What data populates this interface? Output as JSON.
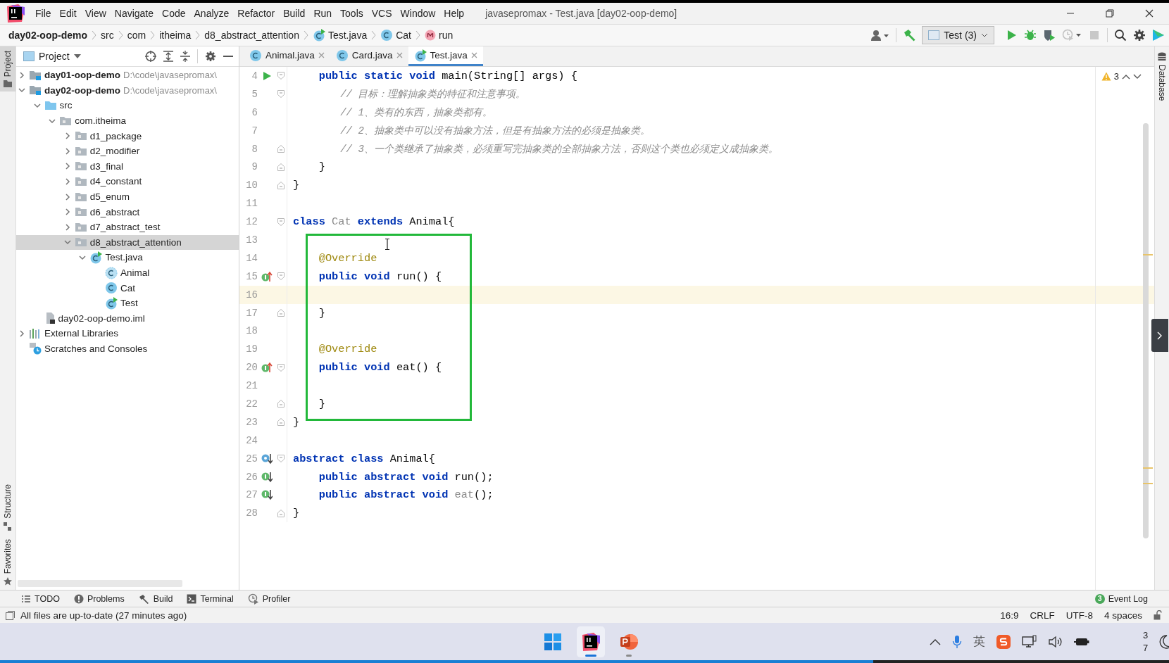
{
  "window": {
    "title": "javasepromax - Test.java [day02-oop-demo]"
  },
  "menu": [
    "File",
    "Edit",
    "View",
    "Navigate",
    "Code",
    "Analyze",
    "Refactor",
    "Build",
    "Run",
    "Tools",
    "VCS",
    "Window",
    "Help"
  ],
  "breadcrumbs": [
    {
      "kind": "module",
      "label": "day02-oop-demo"
    },
    {
      "kind": "folder",
      "label": "src"
    },
    {
      "kind": "folder",
      "label": "com"
    },
    {
      "kind": "folder",
      "label": "itheima"
    },
    {
      "kind": "folder",
      "label": "d8_abstract_attention"
    },
    {
      "kind": "test-class",
      "label": "Test.java"
    },
    {
      "kind": "class",
      "label": "Cat"
    },
    {
      "kind": "method",
      "label": "run"
    }
  ],
  "toolbar": {
    "run_config": "Test (3)",
    "actions": [
      {
        "kind": "run",
        "disabled": false
      },
      {
        "kind": "debug",
        "disabled": false
      },
      {
        "kind": "coverage",
        "disabled": false
      },
      {
        "kind": "profile",
        "disabled": true
      },
      {
        "kind": "stop",
        "disabled": true
      }
    ]
  },
  "left_strip": {
    "top": [
      {
        "label": "Project",
        "selected": true
      }
    ],
    "bottom": [
      {
        "label": "Structure",
        "selected": false
      },
      {
        "label": "Favorites",
        "selected": false
      }
    ]
  },
  "right_strip": [
    {
      "label": "Database"
    }
  ],
  "project": {
    "title": "Project",
    "tree": [
      {
        "kind": "module",
        "label": "day01-oop-demo",
        "hint": "D:\\code\\javasepromax\\",
        "expanded": false,
        "selected": false
      },
      {
        "kind": "module",
        "label": "day02-oop-demo",
        "hint": "D:\\code\\javasepromax\\",
        "expanded": true,
        "selected": false,
        "children": [
          {
            "kind": "source",
            "label": "src",
            "expanded": true,
            "selected": false,
            "children": [
              {
                "kind": "package",
                "label": "com.itheima",
                "expanded": true,
                "selected": false,
                "children": [
                  {
                    "kind": "package",
                    "label": "d1_package",
                    "expanded": false,
                    "selected": false
                  },
                  {
                    "kind": "package",
                    "label": "d2_modifier",
                    "expanded": false,
                    "selected": false
                  },
                  {
                    "kind": "package",
                    "label": "d3_final",
                    "expanded": false,
                    "selected": false
                  },
                  {
                    "kind": "package",
                    "label": "d4_constant",
                    "expanded": false,
                    "selected": false
                  },
                  {
                    "kind": "package",
                    "label": "d5_enum",
                    "expanded": false,
                    "selected": false
                  },
                  {
                    "kind": "package",
                    "label": "d6_abstract",
                    "expanded": false,
                    "selected": false
                  },
                  {
                    "kind": "package",
                    "label": "d7_abstract_test",
                    "expanded": false,
                    "selected": false
                  },
                  {
                    "kind": "package",
                    "label": "d8_abstract_attention",
                    "expanded": true,
                    "selected": true,
                    "children": [
                      {
                        "kind": "test-class",
                        "label": "Test.java",
                        "expanded": true,
                        "selected": false,
                        "children": [
                          {
                            "kind": "abstract-class",
                            "label": "Animal",
                            "selected": false
                          },
                          {
                            "kind": "class",
                            "label": "Cat",
                            "selected": false
                          },
                          {
                            "kind": "test-class",
                            "label": "Test",
                            "selected": false
                          }
                        ]
                      }
                    ]
                  }
                ]
              }
            ]
          },
          {
            "kind": "iml",
            "label": "day02-oop-demo.iml",
            "selected": false
          }
        ]
      },
      {
        "kind": "libraries",
        "label": "External Libraries",
        "expanded": false,
        "selected": false
      },
      {
        "kind": "scratches",
        "label": "Scratches and Consoles",
        "selected": false
      }
    ]
  },
  "editor": {
    "tabs": [
      {
        "label": "Animal.java",
        "selected": false
      },
      {
        "label": "Card.java",
        "selected": false
      },
      {
        "label": "Test.java",
        "selected": true
      }
    ],
    "warnings": "3",
    "lines": [
      {
        "number": "4",
        "current": false,
        "marker": {
          "kind": "run"
        },
        "fold": {
          "kind": "start"
        },
        "tokens": [
          {
            "kind": "keyword",
            "text": "    public static void"
          },
          {
            "kind": "plain",
            "text": " main(String[] args) {"
          }
        ]
      },
      {
        "number": "5",
        "current": false,
        "fold": {
          "kind": "start"
        },
        "tokens": [
          {
            "kind": "comment",
            "text": "        // 目标：理解抽象类的特征和注意事项。"
          }
        ]
      },
      {
        "number": "6",
        "current": false,
        "tokens": [
          {
            "kind": "comment",
            "text": "        // 1、类有的东西，抽象类都有。"
          }
        ]
      },
      {
        "number": "7",
        "current": false,
        "tokens": [
          {
            "kind": "comment",
            "text": "        // 2、抽象类中可以没有抽象方法，但是有抽象方法的必须是抽象类。"
          }
        ]
      },
      {
        "number": "8",
        "current": false,
        "fold": {
          "kind": "end"
        },
        "tokens": [
          {
            "kind": "comment",
            "text": "        // 3、一个类继承了抽象类，必须重写完抽象类的全部抽象方法，否则这个类也必须定义成抽象类。"
          }
        ]
      },
      {
        "number": "9",
        "current": false,
        "fold": {
          "kind": "end"
        },
        "tokens": [
          {
            "kind": "plain",
            "text": "    }"
          }
        ]
      },
      {
        "number": "10",
        "current": false,
        "fold": {
          "kind": "end"
        },
        "tokens": [
          {
            "kind": "plain",
            "text": "}"
          }
        ]
      },
      {
        "number": "11",
        "current": false
      },
      {
        "number": "12",
        "current": false,
        "fold": {
          "kind": "start"
        },
        "tokens": [
          {
            "kind": "keyword",
            "text": "class "
          },
          {
            "kind": "unused",
            "text": "Cat"
          },
          {
            "kind": "keyword",
            "text": " extends"
          },
          {
            "kind": "plain",
            "text": " Animal{"
          }
        ]
      },
      {
        "number": "13",
        "current": false
      },
      {
        "number": "14",
        "current": false,
        "tokens": [
          {
            "kind": "annotation",
            "text": "    @Override"
          }
        ]
      },
      {
        "number": "15",
        "current": false,
        "marker": {
          "kind": "override"
        },
        "fold": {
          "kind": "start"
        },
        "tokens": [
          {
            "kind": "keyword",
            "text": "    public void"
          },
          {
            "kind": "plain",
            "text": " run() {"
          }
        ]
      },
      {
        "number": "16",
        "current": true
      },
      {
        "number": "17",
        "current": false,
        "fold": {
          "kind": "end"
        },
        "tokens": [
          {
            "kind": "plain",
            "text": "    }"
          }
        ]
      },
      {
        "number": "18",
        "current": false
      },
      {
        "number": "19",
        "current": false,
        "tokens": [
          {
            "kind": "annotation",
            "text": "    @Override"
          }
        ]
      },
      {
        "number": "20",
        "current": false,
        "marker": {
          "kind": "override"
        },
        "fold": {
          "kind": "start"
        },
        "tokens": [
          {
            "kind": "keyword",
            "text": "    public void"
          },
          {
            "kind": "plain",
            "text": " eat() {"
          }
        ]
      },
      {
        "number": "21",
        "current": false
      },
      {
        "number": "22",
        "current": false,
        "fold": {
          "kind": "end"
        },
        "tokens": [
          {
            "kind": "plain",
            "text": "    }"
          }
        ]
      },
      {
        "number": "23",
        "current": false,
        "fold": {
          "kind": "end"
        },
        "tokens": [
          {
            "kind": "plain",
            "text": "}"
          }
        ]
      },
      {
        "number": "24",
        "current": false
      },
      {
        "number": "25",
        "current": false,
        "marker": {
          "kind": "class-implemented"
        },
        "fold": {
          "kind": "start"
        },
        "tokens": [
          {
            "kind": "keyword",
            "text": "abstract class"
          },
          {
            "kind": "plain",
            "text": " Animal{"
          }
        ]
      },
      {
        "number": "26",
        "current": false,
        "marker": {
          "kind": "implemented"
        },
        "tokens": [
          {
            "kind": "keyword",
            "text": "    public abstract void"
          },
          {
            "kind": "plain",
            "text": " run();"
          }
        ]
      },
      {
        "number": "27",
        "current": false,
        "marker": {
          "kind": "implemented"
        },
        "tokens": [
          {
            "kind": "keyword",
            "text": "    public abstract void"
          },
          {
            "kind": "unused",
            "text": " eat"
          },
          {
            "kind": "plain",
            "text": "();"
          }
        ]
      },
      {
        "number": "28",
        "current": false,
        "fold": {
          "kind": "end"
        },
        "tokens": [
          {
            "kind": "plain",
            "text": "}"
          }
        ]
      }
    ]
  },
  "tool_tabs": [
    {
      "kind": "todo",
      "label": "TODO"
    },
    {
      "kind": "problems",
      "label": "Problems"
    },
    {
      "kind": "build",
      "label": "Build"
    },
    {
      "kind": "terminal",
      "label": "Terminal"
    },
    {
      "kind": "profiler",
      "label": "Profiler"
    }
  ],
  "event_log": {
    "label": "Event Log",
    "count": "3"
  },
  "status_bar": {
    "message": "All files are up-to-date (27 minutes ago)",
    "position": "16:9",
    "line_separator": "CRLF",
    "encoding": "UTF-8",
    "indent": "4 spaces"
  },
  "taskbar": {
    "apps": [
      {
        "kind": "start",
        "active": false
      },
      {
        "kind": "intellij",
        "active": true
      },
      {
        "kind": "powerpoint",
        "active": false
      }
    ],
    "tray": {
      "input_method": "英",
      "clock": [
        "3",
        "7"
      ]
    }
  }
}
